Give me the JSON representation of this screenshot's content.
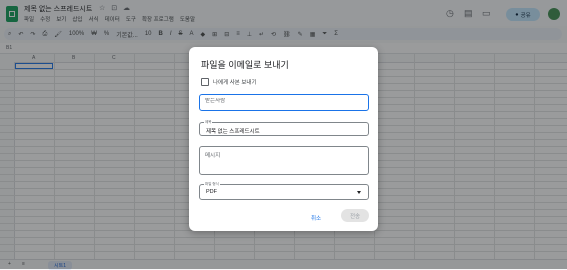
{
  "app": {
    "title": "제목 없는 스프레드시트",
    "menus": [
      "파일",
      "수정",
      "보기",
      "삽입",
      "서식",
      "데이터",
      "도구",
      "확장 프로그램",
      "도움말"
    ],
    "share_label": "공유",
    "title_icons": "☆ ⊡ ☁"
  },
  "toolbar": {
    "zoom": "100%",
    "currency": "₩",
    "percent": "%",
    "font": "기본값...",
    "font_size": "10"
  },
  "formula_bar": {
    "cell_ref": "B1"
  },
  "grid": {
    "columns": [
      "A",
      "B",
      "C"
    ]
  },
  "sheet_tabs": [
    "시트1"
  ],
  "dialog": {
    "title": "파일을 이메일로 보내기",
    "send_to_me_label": "나에게 사본 보내기",
    "recipients_placeholder": "받는사람",
    "subject_label": "제목",
    "subject_value": "제목 없는 스프레드시트",
    "message_placeholder": "메시지",
    "format_label": "파일 형식",
    "format_value": "PDF",
    "cancel_label": "취소",
    "send_label": "전송"
  },
  "colors": {
    "accent": "#1a73e8",
    "sheets_green": "#0f9d58",
    "share_bg": "#c2e7ff"
  }
}
